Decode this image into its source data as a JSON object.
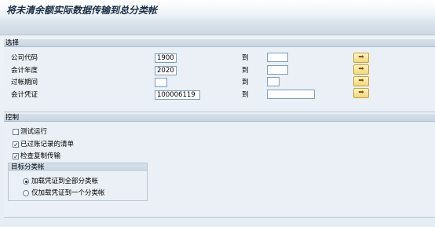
{
  "window": {
    "title": "将未清余额实际数据传输到总分类帐"
  },
  "selection": {
    "title": "选择",
    "rows": [
      {
        "label": "公司代码",
        "from": "1900",
        "to_label": "到",
        "to": ""
      },
      {
        "label": "会计年度",
        "from": "2020",
        "to_label": "到",
        "to": ""
      },
      {
        "label": "过帐期间",
        "from": "",
        "to_label": "到",
        "to": ""
      },
      {
        "label": "会计凭证",
        "from": "100006119",
        "to_label": "到",
        "to": ""
      }
    ]
  },
  "control": {
    "title": "控制",
    "options": [
      {
        "label": "测试运行",
        "checked": false
      },
      {
        "label": "已过账记录的清单",
        "checked": true
      },
      {
        "label": "检查复制传输",
        "checked": true
      }
    ],
    "target_ledger": {
      "title": "目标分类帐",
      "options": [
        {
          "label": "加载凭证到全部分类帐",
          "selected": true
        },
        {
          "label": "仅加载凭证到一个分类帐",
          "selected": false
        }
      ]
    }
  },
  "icons": {
    "multiple_selection": "arrow-right-icon"
  },
  "colors": {
    "button_fill": "#f4d67a",
    "header": "#1b2e44"
  }
}
